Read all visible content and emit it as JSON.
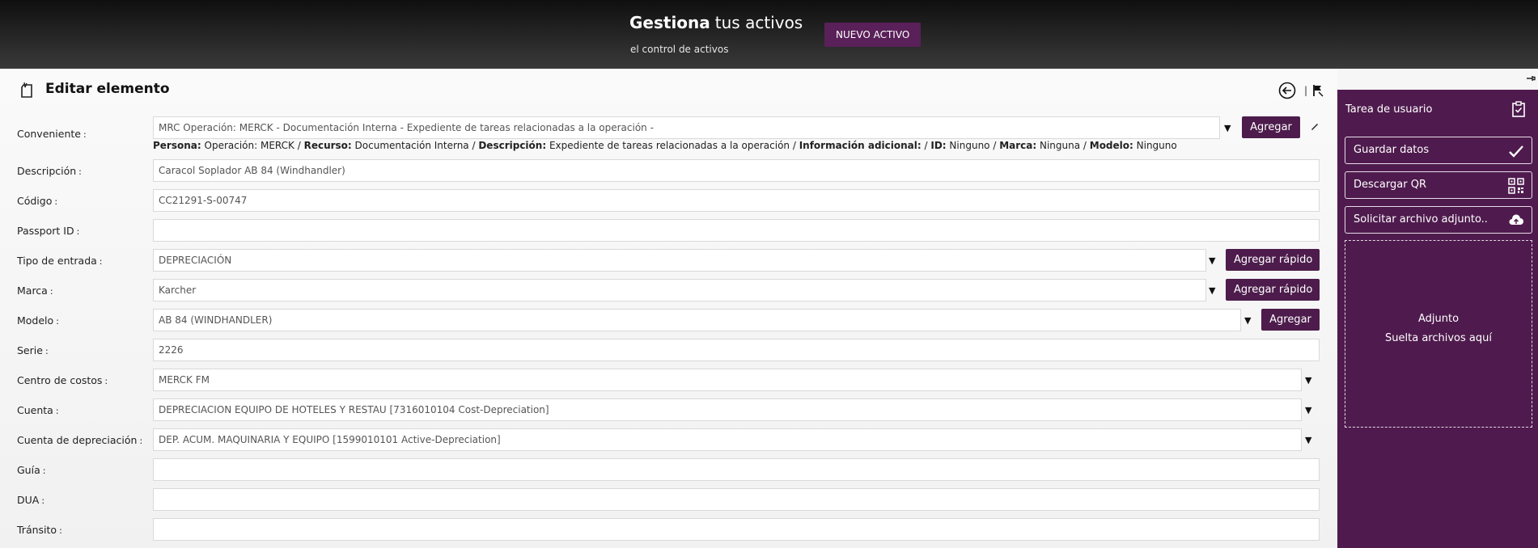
{
  "header": {
    "title_bold": "Gestiona",
    "title_light": "tus activos",
    "subtitle": "el control de activos",
    "new_asset_label": "NUEVO ACTIVO"
  },
  "page": {
    "title": "Editar elemento",
    "separator": "|"
  },
  "form": {
    "colon": ":",
    "conveniente": {
      "label": "Conveniente",
      "value": "MRC Operación: MERCK - Documentación Interna - Expediente de tareas relacionadas a la operación -",
      "button": "Agregar"
    },
    "details": [
      {
        "k": "Persona:",
        "v": " Operación: MERCK / "
      },
      {
        "k": "Recurso:",
        "v": " Documentación Interna / "
      },
      {
        "k": "Descripción:",
        "v": " Expediente de tareas relacionadas a la operación / "
      },
      {
        "k": "Información adicional:",
        "v": " / "
      },
      {
        "k": "ID:",
        "v": " Ninguno / "
      },
      {
        "k": "Marca:",
        "v": " Ninguna / "
      },
      {
        "k": "Modelo:",
        "v": " Ninguno"
      }
    ],
    "descripcion": {
      "label": "Descripción",
      "value": "Caracol Soplador AB 84 (Windhandler)"
    },
    "codigo": {
      "label": "Código",
      "value": "CC21291-S-00747"
    },
    "passport": {
      "label": "Passport ID",
      "value": ""
    },
    "tipo_entrada": {
      "label": "Tipo de entrada",
      "value": "DEPRECIACIÓN",
      "button": "Agregar rápido"
    },
    "marca": {
      "label": "Marca",
      "value": "Karcher",
      "button": "Agregar rápido"
    },
    "modelo": {
      "label": "Modelo",
      "value": "AB 84 (WINDHANDLER)",
      "button": "Agregar"
    },
    "serie": {
      "label": "Serie",
      "value": "2226"
    },
    "centro_costos": {
      "label": "Centro de costos",
      "value": "MERCK FM"
    },
    "cuenta": {
      "label": "Cuenta",
      "value": "DEPRECIACION EQUIPO DE HOTELES Y RESTAU [7316010104 Cost-Depreciation]"
    },
    "cuenta_depreciacion": {
      "label": "Cuenta de depreciación",
      "value": "DEP. ACUM. MAQUINARIA Y EQUIPO [1599010101 Active-Depreciation]"
    },
    "guia": {
      "label": "Guía",
      "value": ""
    },
    "dua": {
      "label": "DUA",
      "value": ""
    },
    "transito": {
      "label": "Tránsito",
      "value": ""
    }
  },
  "sidebar": {
    "title": "Tarea de usuario",
    "save": "Guardar datos",
    "qr": "Descargar QR",
    "attach": "Solicitar archivo adjunto..",
    "dropzone_title": "Adjunto",
    "dropzone_hint": "Suelta archivos aquí"
  },
  "colors": {
    "primary": "#4f1b4e",
    "header_dark": "#1a1a1a"
  }
}
